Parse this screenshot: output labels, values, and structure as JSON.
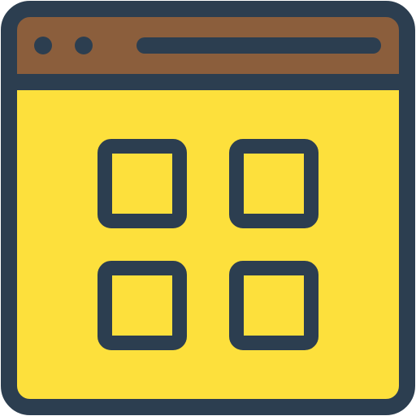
{
  "icon": {
    "name": "browser-app-grid-icon",
    "colors": {
      "outline": "#2c3e50",
      "title_bar": "#8b5e3c",
      "body": "#fde03c",
      "tile": "#fde03c"
    },
    "title_bar": {
      "buttons": [
        "window-dot",
        "window-dot"
      ],
      "has_address_bar": true
    },
    "grid": {
      "rows": 2,
      "columns": 2,
      "tile_count": 4
    }
  }
}
